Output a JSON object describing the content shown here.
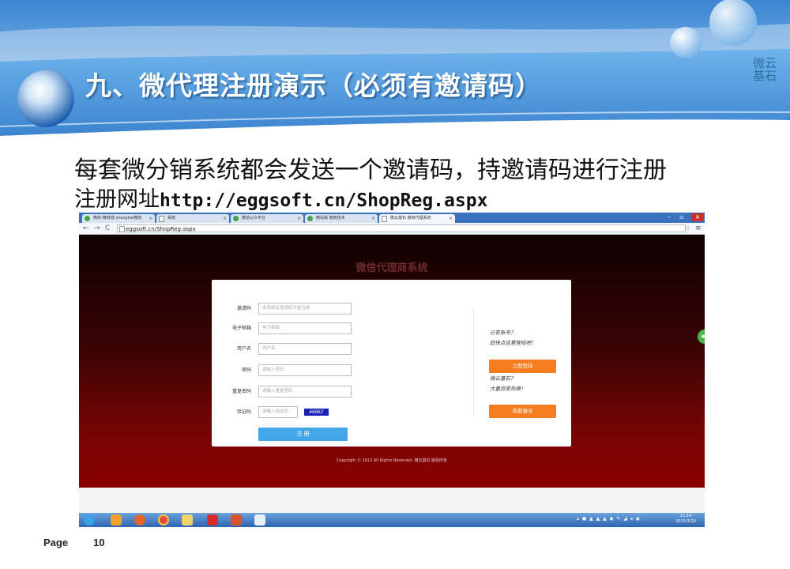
{
  "slide": {
    "title": "九、微代理注册演示（必须有邀请码）",
    "logo_line1": "微云",
    "logo_line2": "基石",
    "body_line1": "每套微分销系统都会发送一个邀请码，持邀请码进行注册",
    "body_line2_prefix": "注册网址",
    "body_line2_url": "http://eggsoft.cn/ShopReg.aspx",
    "footer_label": "Page",
    "footer_page": "10"
  },
  "browser": {
    "tabs": [
      {
        "label": "微商-微商城 shanghai微商",
        "icon": "wechat-icon"
      },
      {
        "label": "系统",
        "icon": "document-icon"
      },
      {
        "label": "微信公众平台",
        "icon": "wechat-icon"
      },
      {
        "label": "微站缘 微商技术",
        "icon": "wechat-icon"
      },
      {
        "label": "微云基石 微商代理系统",
        "icon": "document-icon"
      }
    ],
    "address": "eggsoft.cn/ShopReg.aspx",
    "window_close": "×"
  },
  "webpage": {
    "site_title": "微信代理商系统",
    "form": {
      "invite_label": "邀请码",
      "invite_placeholder": "本系统有邀请码才能注册",
      "email_label": "电子邮箱",
      "email_placeholder": "电子邮箱",
      "username_label": "用户名",
      "username_placeholder": "用户名",
      "password_label": "密码",
      "password_placeholder": "请输入密码",
      "repeat_label": "重复密码",
      "repeat_placeholder": "请输入重复密码",
      "captcha_label": "验证码",
      "captcha_placeholder": "请输入验证码",
      "captcha_value": "66862",
      "register_button": "注  册"
    },
    "side": {
      "have_account": "已有账号？",
      "login_hint": "赶快点这里登陆吧！",
      "login_button": "立即登陆",
      "brand_question": "微云基石？",
      "brand_hint": "大量商家热捧！",
      "demo_button": "观看展示"
    },
    "copyright": "Copyright © 2013  All Rights Reserved. 微云基石 版权所有"
  },
  "taskbar": {
    "clock_time": "11:14",
    "clock_date": "2015/3/19"
  },
  "colors": {
    "header_blue": "#4a8fd6",
    "page_red": "#8a0000",
    "orange_button": "#f57d1f",
    "blue_button": "#44a6ea"
  }
}
